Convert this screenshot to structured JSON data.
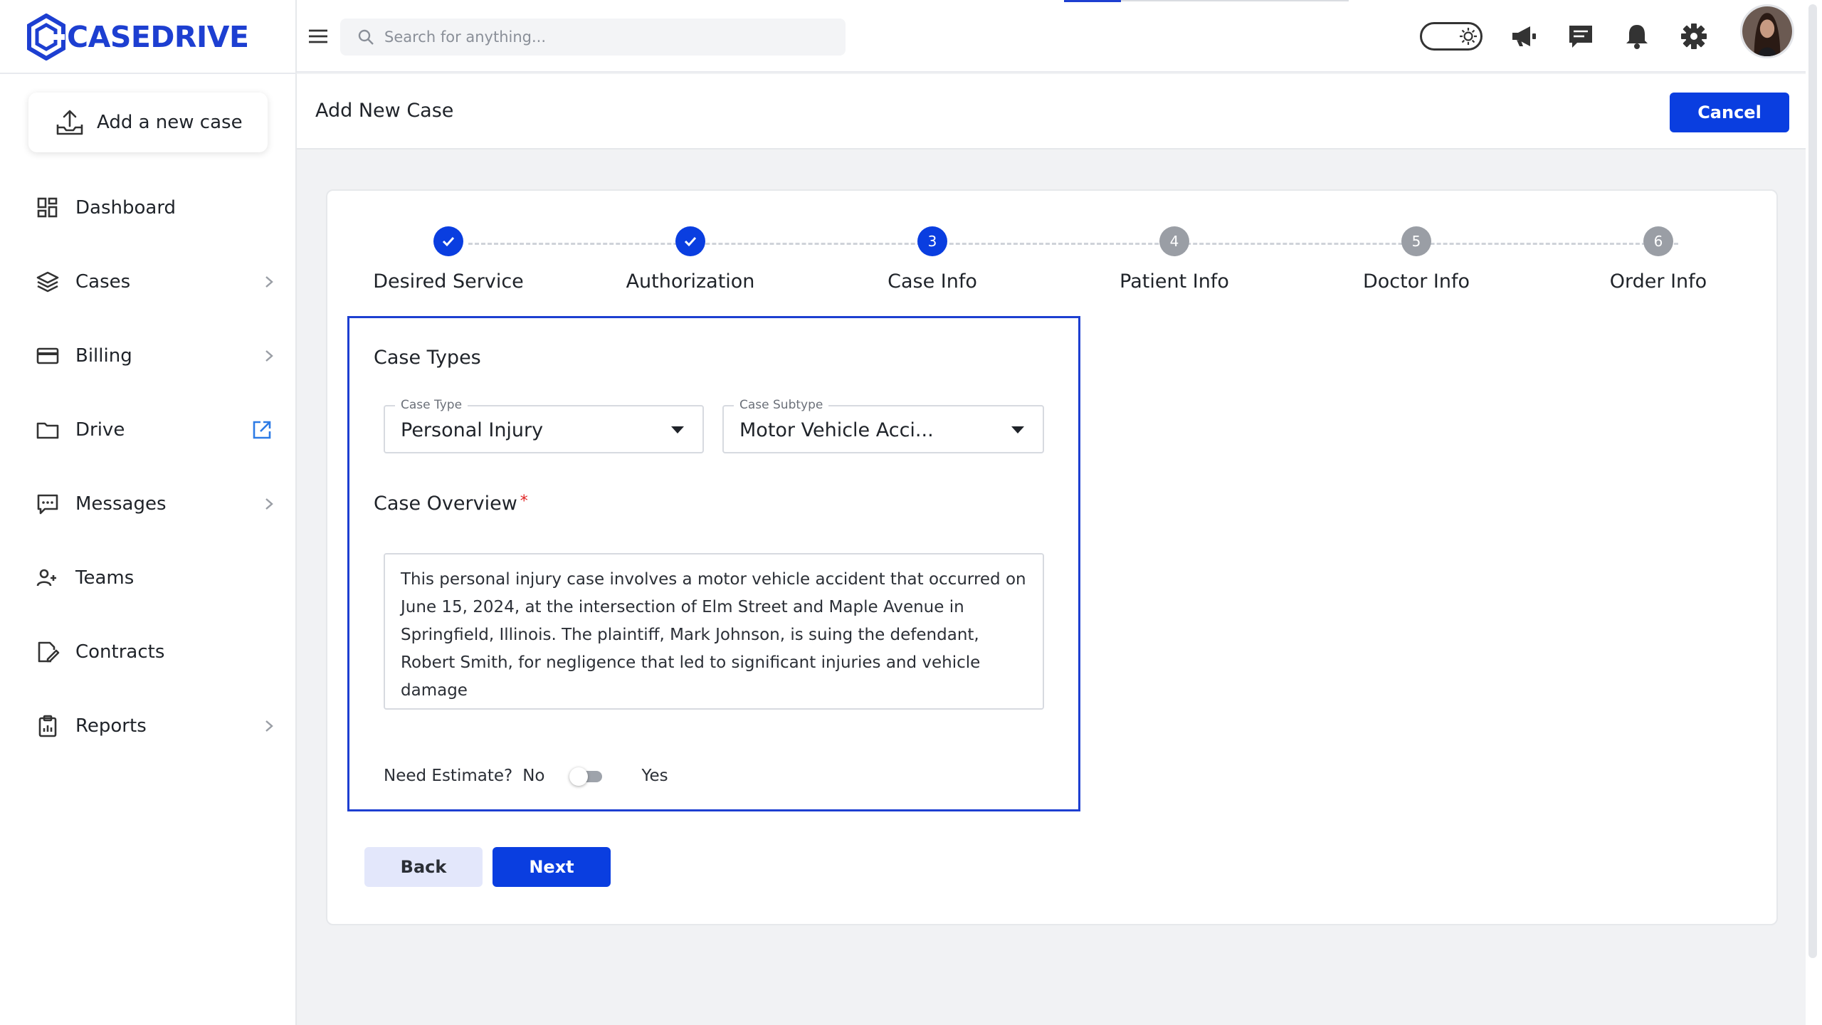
{
  "brand": {
    "name": "CASEDRIVE",
    "color": "#1d3fd1"
  },
  "sidebar": {
    "add_case_label": "Add a new case",
    "items": [
      {
        "label": "Dashboard",
        "icon": "dashboard-icon",
        "has_chevron": false
      },
      {
        "label": "Cases",
        "icon": "layers-icon",
        "has_chevron": true
      },
      {
        "label": "Billing",
        "icon": "credit-card-icon",
        "has_chevron": true
      },
      {
        "label": "Drive",
        "icon": "folder-icon",
        "has_external": true
      },
      {
        "label": "Messages",
        "icon": "message-icon",
        "has_chevron": true
      },
      {
        "label": "Teams",
        "icon": "users-icon",
        "has_chevron": false
      },
      {
        "label": "Contracts",
        "icon": "contract-icon",
        "has_chevron": false
      },
      {
        "label": "Reports",
        "icon": "clipboard-icon",
        "has_chevron": true
      }
    ]
  },
  "topbar": {
    "search_placeholder": "Search for anything...",
    "icons": [
      "menu-icon",
      "theme-toggle",
      "megaphone-icon",
      "chat-icon",
      "bell-icon",
      "gear-icon",
      "avatar"
    ]
  },
  "page": {
    "title": "Add New Case",
    "cancel_label": "Cancel"
  },
  "stepper": {
    "steps": [
      {
        "label": "Desired Service",
        "state": "done",
        "number": "1"
      },
      {
        "label": "Authorization",
        "state": "done",
        "number": "2"
      },
      {
        "label": "Case Info",
        "state": "active",
        "number": "3"
      },
      {
        "label": "Patient Info",
        "state": "pending",
        "number": "4"
      },
      {
        "label": "Doctor Info",
        "state": "pending",
        "number": "5"
      },
      {
        "label": "Order Info",
        "state": "pending",
        "number": "6"
      }
    ]
  },
  "form": {
    "case_types_title": "Case Types",
    "case_type": {
      "label": "Case Type",
      "value": "Personal Injury"
    },
    "case_subtype": {
      "label": "Case Subtype",
      "value": "Motor Vehicle Acci..."
    },
    "overview_title": "Case Overview",
    "required_mark": "*",
    "overview_text": "This personal injury case involves a motor vehicle accident that occurred on June 15, 2024, at the intersection of Elm Street and Maple Avenue in Springfield, Illinois. The plaintiff, Mark Johnson, is suing the defendant, Robert Smith, for negligence that led to significant injuries and vehicle damage",
    "estimate_label": "Need Estimate?",
    "estimate_no": "No",
    "estimate_yes": "Yes",
    "estimate_value": false
  },
  "actions": {
    "back_label": "Back",
    "next_label": "Next"
  },
  "colors": {
    "primary": "#0a3ee0",
    "back_bg": "#e3e7fb",
    "required": "#e02424"
  }
}
